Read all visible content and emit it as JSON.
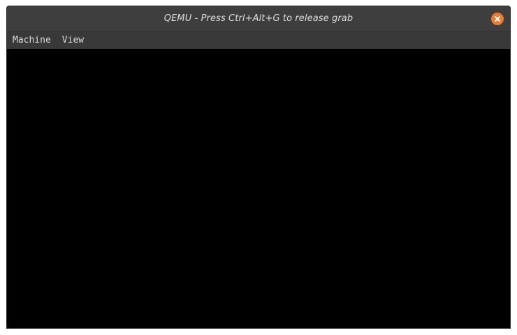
{
  "window": {
    "title": "QEMU - Press Ctrl+Alt+G to release grab",
    "close_icon": "close-icon",
    "accent_color": "#f07a2e"
  },
  "menubar": {
    "items": [
      {
        "label": "Machine"
      },
      {
        "label": "View"
      }
    ]
  },
  "screen": {
    "background": "#000000"
  }
}
